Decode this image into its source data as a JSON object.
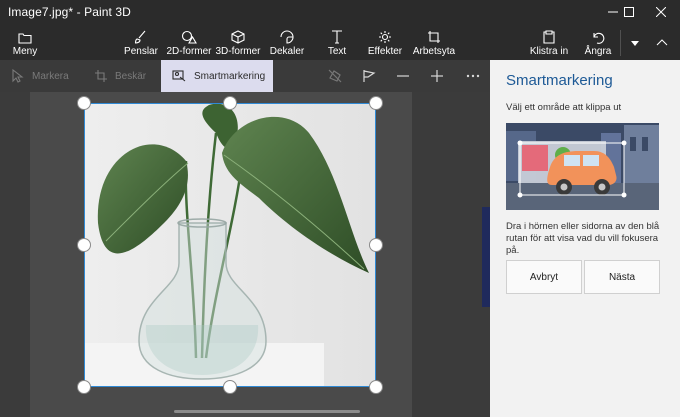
{
  "window": {
    "title": "Image7.jpg* - Paint 3D",
    "controls": [
      "minimize-icon",
      "maximize-icon",
      "close-icon"
    ]
  },
  "ribbon": {
    "menu_label": "Meny",
    "tools": [
      {
        "label": "Penslar",
        "icon": "brush-icon"
      },
      {
        "label": "2D-former",
        "icon": "shapes-2d-icon"
      },
      {
        "label": "3D-former",
        "icon": "cube-icon"
      },
      {
        "label": "Dekaler",
        "icon": "sticker-icon"
      },
      {
        "label": "Text",
        "icon": "text-icon"
      },
      {
        "label": "Effekter",
        "icon": "effects-icon"
      },
      {
        "label": "Arbetsyta",
        "icon": "canvas-icon"
      }
    ],
    "paste_label": "Klistra in",
    "undo_label": "Ångra"
  },
  "subtoolbar": {
    "select_label": "Markera",
    "crop_label": "Beskär",
    "magic_select_label": "Smartmarkering",
    "magic_select_active": true
  },
  "panel": {
    "title": "Smartmarkering",
    "instruction": "Välj ett område att klippa ut",
    "description": "Dra i hörnen eller sidorna av den blå rutan för att visa vad du vill fokusera på.",
    "cancel_label": "Avbryt",
    "next_label": "Nästa"
  },
  "colors": {
    "chrome": "#2b2b2b",
    "accent": "#1e5a96",
    "selection": "#2f8ad6",
    "panel_bg": "#f2f2f2"
  }
}
